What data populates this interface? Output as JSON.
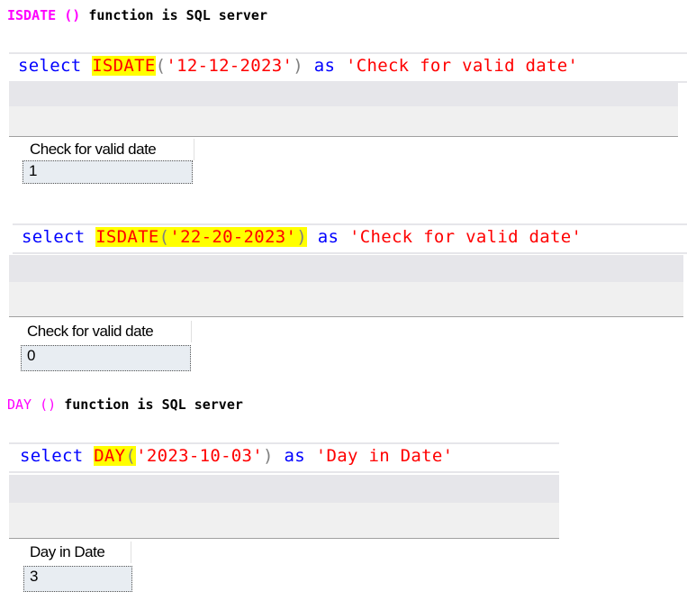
{
  "sections": [
    {
      "heading": {
        "function": "ISDATE ()",
        "rest": "function is SQL server"
      },
      "queries": [
        {
          "keyword_select": "select",
          "function": "ISDATE",
          "open_paren": "(",
          "argument": "'12-12-2023'",
          "close_paren": ")",
          "keyword_as": "as",
          "alias": "'Check for valid date'",
          "result": {
            "column": "Check for valid date",
            "value": "1"
          }
        },
        {
          "keyword_select": "select",
          "function": "ISDATE",
          "open_paren": "(",
          "argument": "'22-20-2023'",
          "close_paren": ")",
          "keyword_as": "as",
          "alias": "'Check for valid date'",
          "result": {
            "column": "Check for valid date",
            "value": "0"
          }
        }
      ]
    },
    {
      "heading": {
        "function": "DAY ()",
        "rest": "function is SQL server"
      },
      "queries": [
        {
          "keyword_select": "select",
          "function": "DAY",
          "open_paren": "(",
          "argument": "'2023-10-03'",
          "close_paren": ")",
          "keyword_as": "as",
          "alias": "'Day in Date'",
          "result": {
            "column": "Day in Date",
            "value": "3"
          }
        }
      ]
    }
  ],
  "colors": {
    "keyword": "#0000ff",
    "string": "#ff0000",
    "heading_function": "#ff00ff",
    "highlight": "#ffff00"
  }
}
